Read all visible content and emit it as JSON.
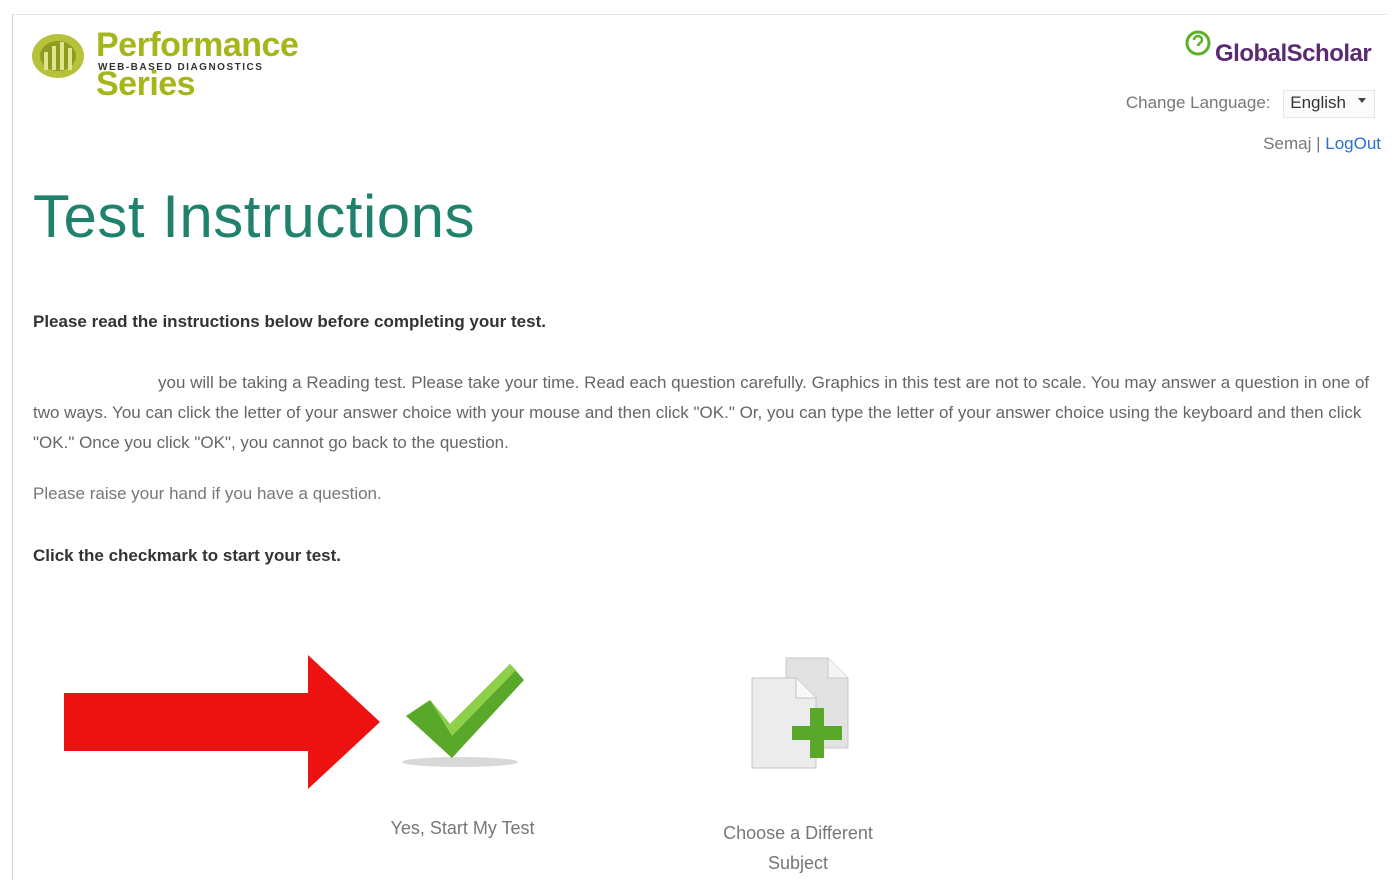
{
  "header": {
    "brand_name": "Performance Series",
    "brand_tagline": "WEB-BASED DIAGNOSTICS",
    "partner_logo": "GlobalScholar",
    "language_label": "Change Language:",
    "language_selected": "English",
    "username": "Semaj",
    "separator": "|",
    "logout_label": "LogOut"
  },
  "page": {
    "title": "Test Instructions",
    "lead": "Please read the instructions below before completing your test.",
    "instructions": "you will be taking a Reading test. Please take your time. Read each question carefully. Graphics in this test are not to scale. You may answer a question in one of two ways. You can click the letter of your answer choice with your mouse and then click \"OK.\" Or, you can type the letter of your answer choice using the keyboard and then click \"OK.\" Once you click \"OK\", you cannot go back to the question.",
    "raise_hand": "Please raise your hand if you have a question.",
    "start_prompt": "Click the checkmark to start your test."
  },
  "actions": {
    "start_label": "Yes, Start My Test",
    "different_subject_label": "Choose a Different Subject"
  },
  "icons": [
    "logo-icon",
    "globalscholar-icon",
    "red-arrow-icon",
    "checkmark-icon",
    "add-document-icon"
  ],
  "colors": {
    "title": "#20826d",
    "brand": "#a6b61a",
    "partner": "#5a2a73",
    "link": "#2b6fcf",
    "check": "#5aa82a",
    "arrow": "#ee1111"
  }
}
